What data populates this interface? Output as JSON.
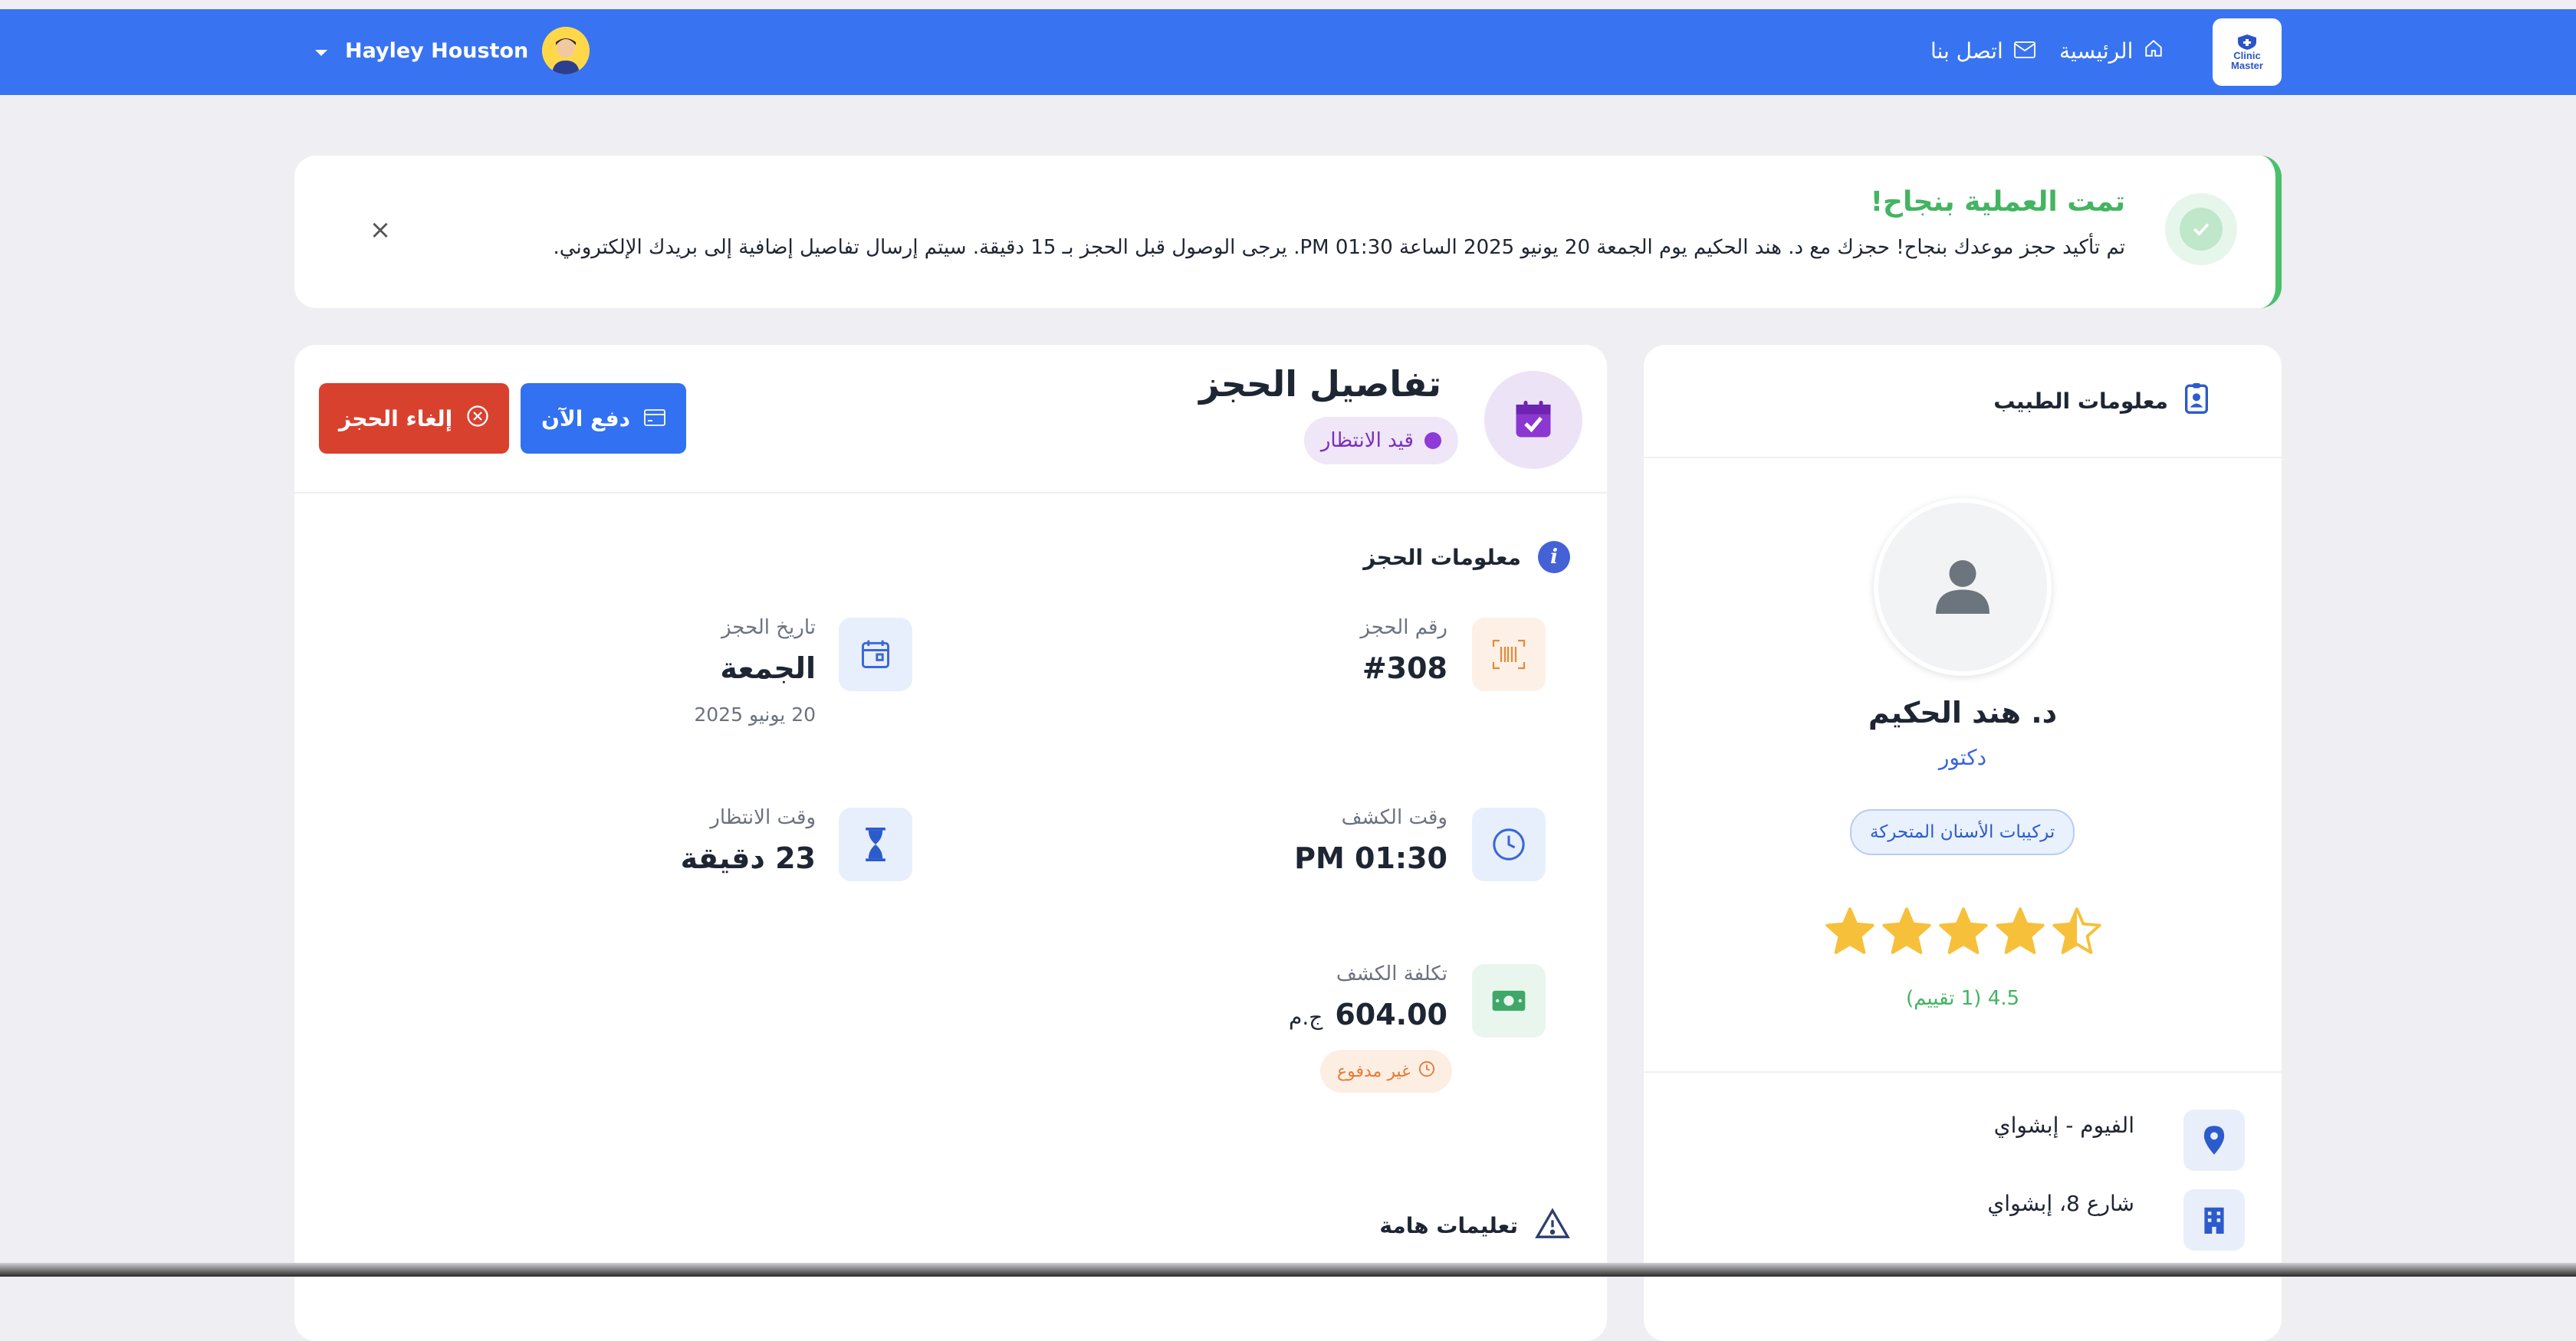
{
  "navbar": {
    "logo_text": [
      "Clinic",
      "Master"
    ],
    "home_label": "الرئيسية",
    "contact_label": "اتصل بنا",
    "user_name": "Hayley Houston"
  },
  "alert": {
    "title": "تمت العملية بنجاح!",
    "message": "تم تأكيد حجز موعدك بنجاح! حجزك مع د. هند الحكيم يوم الجمعة 20 يونيو 2025 الساعة 01:30 PM. يرجى الوصول قبل الحجز بـ 15 دقيقة. سيتم إرسال تفاصيل إضافية إلى بريدك الإلكتروني.",
    "close_symbol": "×"
  },
  "booking": {
    "title": "تفاصيل الحجز",
    "status": "قيد الانتظار",
    "pay_button": "دفع الآن",
    "cancel_button": "إلغاء الحجز",
    "info_section_title": "معلومات الحجز",
    "number_label": "رقم الحجز",
    "number_value": "#308",
    "date_label": "تاريخ الحجز",
    "date_day": "الجمعة",
    "date_full": "20 يونيو 2025",
    "time_label": "وقت الكشف",
    "time_value": "PM 01:30",
    "wait_label": "وقت الانتظار",
    "wait_value": "23 دقيقة",
    "cost_label": "تكلفة الكشف",
    "cost_value": "604.00",
    "cost_currency": "ج.م",
    "payment_status": "غير مدفوع",
    "instructions_title": "تعليمات هامة"
  },
  "doctor": {
    "section_title": "معلومات الطبيب",
    "name": "د. هند الحكيم",
    "role": "دكتور",
    "specialty": "تركيبات الأسنان المتحركة",
    "rating": 4.5,
    "rating_text": "4.5 (1 تقييم)",
    "city": "الفيوم - إبشواي",
    "address": "شارع 8، إبشواي"
  },
  "colors": {
    "navbar": "#3873f1",
    "success": "#43b461",
    "pay": "#3271f1",
    "cancel": "#d9412f",
    "pending": "#8e3bd8",
    "star": "#f7c03a"
  }
}
